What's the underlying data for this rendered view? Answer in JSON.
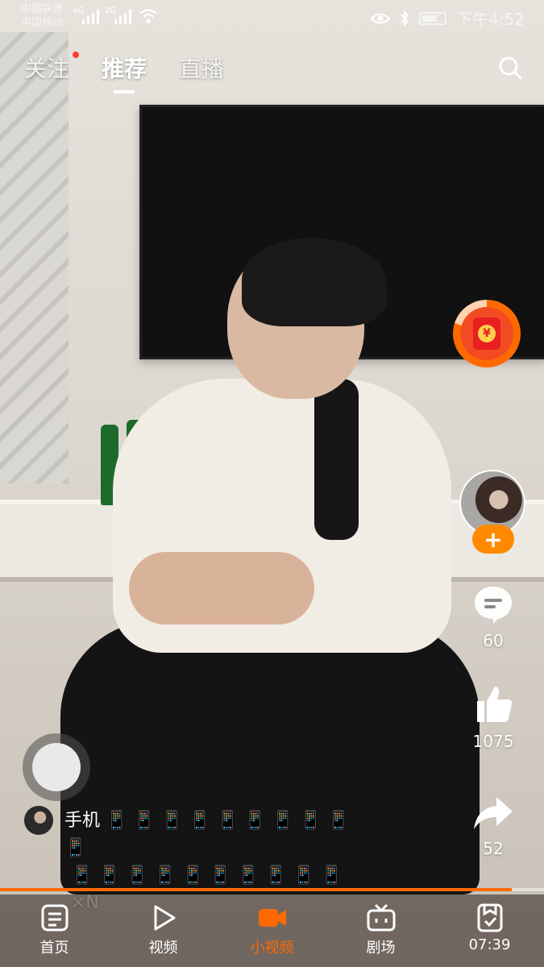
{
  "status_bar": {
    "carrier_1": "中国联通",
    "carrier_2": "中国移动",
    "net_1": "4G",
    "net_2": "2G",
    "time": "下午4:52"
  },
  "top_tabs": [
    {
      "label": "关注",
      "has_dot": true
    },
    {
      "label": "推荐",
      "active": true
    },
    {
      "label": "直播"
    }
  ],
  "actions": {
    "comment_count": "60",
    "like_count": "1075",
    "share_count": "52"
  },
  "caption": {
    "line1": "手机 📱 📱 📱 📱 📱 📱 📱 📱 📱 📱",
    "line2": "📱 📱 📱 📱 📱 📱 📱 📱 📱 📱 ×N"
  },
  "progress": 0.94,
  "bottom_nav": [
    {
      "label": "首页",
      "icon": "home-icon"
    },
    {
      "label": "视频",
      "icon": "play-icon"
    },
    {
      "label": "小视频",
      "icon": "small-video-icon",
      "active": true
    },
    {
      "label": "剧场",
      "icon": "tv-icon"
    },
    {
      "label": "07:39",
      "icon": "task-icon"
    }
  ],
  "colors": {
    "accent": "#ff6a00",
    "badge": "#ff3b30"
  }
}
